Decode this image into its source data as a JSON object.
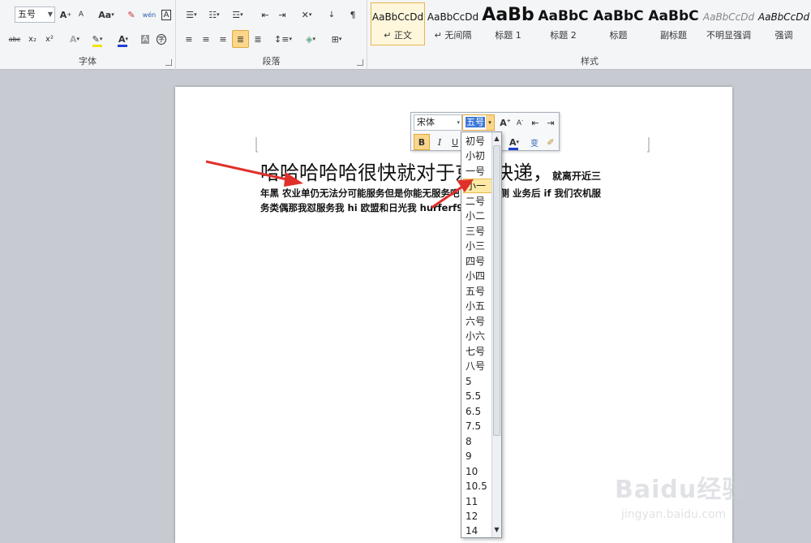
{
  "ribbon": {
    "font_group": {
      "label": "字体",
      "size_value": "五号",
      "grow_label": "A",
      "shrink_label": "A",
      "case_label": "Aa",
      "wen_label": "wén",
      "char_border_label": "A",
      "strike_label": "abc",
      "sub_label": "x₂",
      "sup_label": "x²",
      "font_color_label": "A",
      "shade_label": "A",
      "enclose_label": "字"
    },
    "paragraph_group": {
      "label": "段落"
    },
    "styles_group": {
      "label": "样式",
      "tiles": [
        {
          "sample": "AaBbCcDd",
          "name": "↵ 正文"
        },
        {
          "sample": "AaBbCcDd",
          "name": "↵ 无间隔"
        },
        {
          "sample": "AaBb",
          "name": "标题 1"
        },
        {
          "sample": "AaBbC",
          "name": "标题 2"
        },
        {
          "sample": "AaBbC",
          "name": "标题"
        },
        {
          "sample": "AaBbC",
          "name": "副标题"
        },
        {
          "sample": "AaBbCcDd",
          "name": "不明显强调"
        },
        {
          "sample": "AaBbCcDd",
          "name": "强调"
        }
      ]
    }
  },
  "mini_toolbar": {
    "font_name": "宋体",
    "font_size": "五号",
    "bold_label": "B",
    "italic_label": "I",
    "underline_label": "U",
    "font_color_label": "A"
  },
  "document": {
    "line1_big": "哈哈哈哈哈很快就对于京东快递，",
    "line1_small": "就离开近三",
    "line2": "年黑 农业单仍无法分可能服务但是你能无服务吧                超范围抗侧 业务后 if 我们农机服",
    "line3": "务类偶那我怼服务我 hi 欧盟和日光我 hurferf9r"
  },
  "font_size_dropdown": {
    "highlighted": "小一",
    "items": [
      "初号",
      "小初",
      "一号",
      "小一",
      "二号",
      "小二",
      "三号",
      "小三",
      "四号",
      "小四",
      "五号",
      "小五",
      "六号",
      "小六",
      "七号",
      "八号",
      "5",
      "5.5",
      "6.5",
      "7.5",
      "8",
      "9",
      "10",
      "10.5",
      "11",
      "12",
      "14"
    ]
  },
  "watermark": {
    "top": "Baidu经验",
    "bottom": "jingyan.baidu.com"
  },
  "colors": {
    "highlight": "#fde9a5",
    "arrow": "#e0302a",
    "font_color_bar": "#1f3fd0",
    "shade_bar": "#f2e400"
  }
}
